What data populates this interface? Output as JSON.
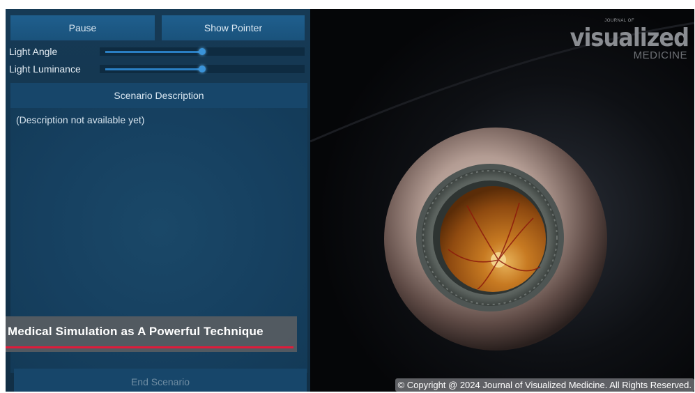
{
  "controls": {
    "pause_label": "Pause",
    "show_pointer_label": "Show Pointer",
    "light_angle_label": "Light Angle",
    "light_angle_value": 0.5,
    "light_luminance_label": "Light Luminance",
    "light_luminance_value": 0.5
  },
  "scenario": {
    "header": "Scenario Description",
    "text": "(Description not available yet)",
    "end_label": "End Scenario"
  },
  "caption": {
    "text": "Medical Simulation as A Powerful Technique"
  },
  "logo": {
    "small": "JOURNAL OF",
    "big": "visualized",
    "sub": "MEDICINE"
  },
  "copyright": "© Copyright @ 2024 Journal of Visualized Medicine. All Rights Reserved.",
  "colors": {
    "panel": "#163a55",
    "button": "#1f5f8e",
    "accent_red": "#e01b3a"
  }
}
